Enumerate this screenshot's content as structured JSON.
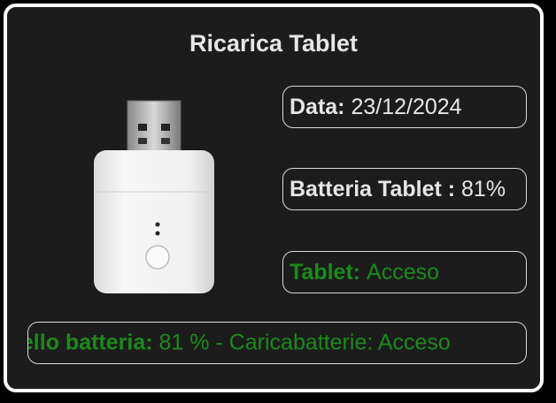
{
  "card": {
    "title": "Ricarica Tablet",
    "date_label": "Data:",
    "date_value": "23/12/2024",
    "battery_label": "Batteria Tablet :",
    "battery_value": "81%",
    "tablet_label": "Tablet:",
    "tablet_value": "Acceso",
    "marquee_label": "vello batteria:",
    "marquee_value": "81 % - Caricabatterie: Acceso"
  },
  "image": {
    "icon": "usb-charger-image"
  },
  "colors": {
    "background": "#1c1c1c",
    "border": "#ffffff",
    "text": "#e6e6e6",
    "status_green": "#1a8a1a"
  }
}
